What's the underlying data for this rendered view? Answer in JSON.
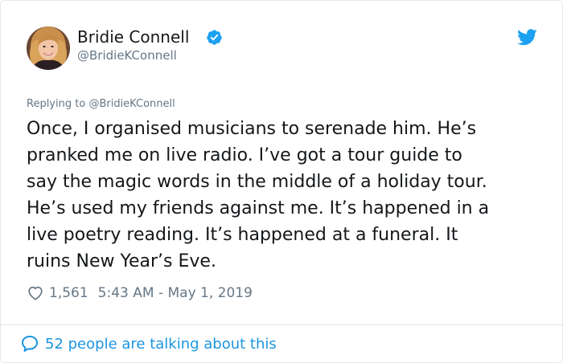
{
  "author": {
    "display_name": "Bridie Connell",
    "handle": "@BridieKConnell",
    "verified_icon": "verified-badge-icon",
    "avatar": "profile-photo"
  },
  "brand": {
    "icon": "twitter-bird-icon",
    "color": "#1da1f2"
  },
  "reply": {
    "prefix": "Replying to",
    "mention": "@BridieKConnell"
  },
  "tweet": {
    "lines": [
      "Once, I organised musicians to serenade him. He’s",
      "pranked me on live radio. I’ve got a tour guide to",
      "say the magic words in the middle of a holiday tour.",
      "He’s used my friends against me. It’s happened in a",
      "live poetry reading. It’s happened at a funeral. It",
      "ruins New Year’s Eve."
    ]
  },
  "meta": {
    "likes": "1,561",
    "timestamp": "5:43 AM - May 1, 2019",
    "heart_icon": "heart-outline-icon"
  },
  "footer": {
    "talking_text": "52 people are talking about this",
    "bubble_icon": "speech-bubble-icon",
    "link_color": "#1b95e0"
  },
  "colors": {
    "text": "#14171a",
    "secondary": "#657786",
    "verified": "#1da1f2",
    "border": "#e1e8ed"
  }
}
